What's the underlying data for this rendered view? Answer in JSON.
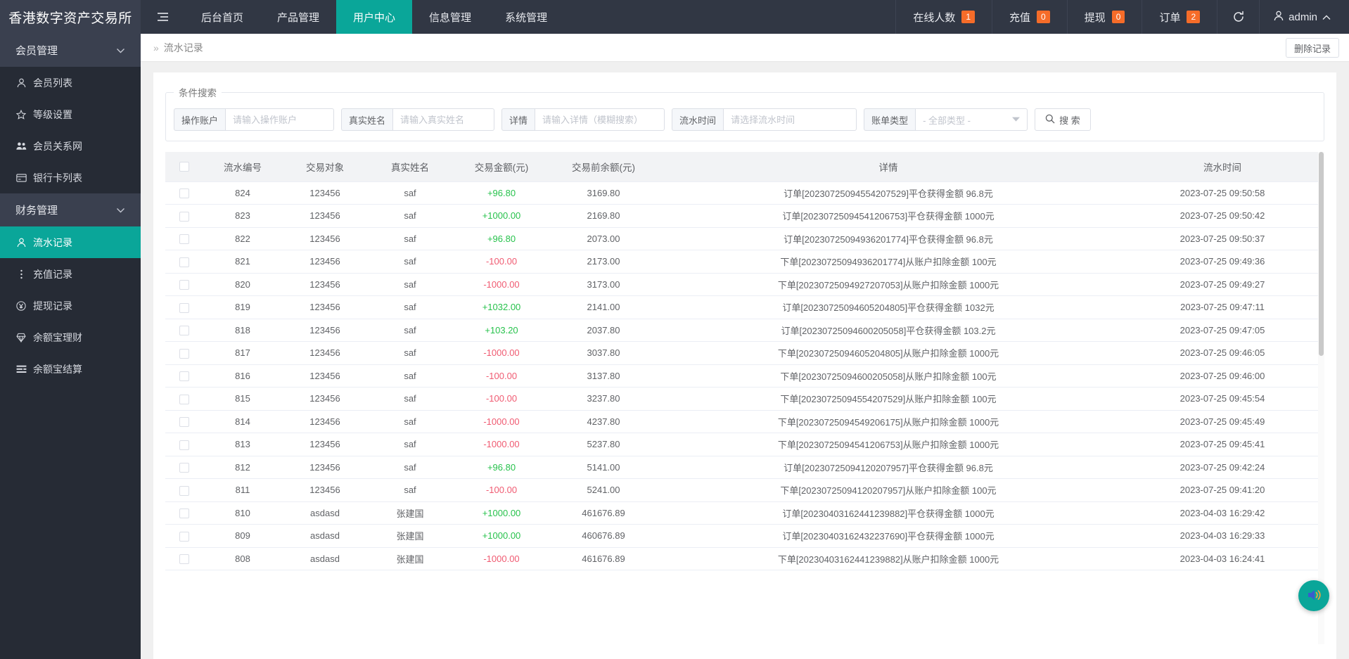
{
  "header": {
    "brand": "香港数字资产交易所",
    "burger_icon": "hamburger-icon",
    "nav": [
      {
        "label": "后台首页",
        "active": false
      },
      {
        "label": "产品管理",
        "active": false
      },
      {
        "label": "用户中心",
        "active": true
      },
      {
        "label": "信息管理",
        "active": false
      },
      {
        "label": "系统管理",
        "active": false
      }
    ],
    "stats": [
      {
        "label": "在线人数",
        "value": "1"
      },
      {
        "label": "充值",
        "value": "0"
      },
      {
        "label": "提现",
        "value": "0"
      },
      {
        "label": "订单",
        "value": "2"
      }
    ],
    "refresh_icon": "refresh-icon",
    "user": {
      "name": "admin",
      "avatar_icon": "user-icon",
      "caret_icon": "chevron-up-icon"
    },
    "badge_color": "#f56c29",
    "accent_color": "#0aa699"
  },
  "sidebar": {
    "groups": [
      {
        "label": "会员管理",
        "items": [
          {
            "label": "会员列表",
            "icon": "user-icon",
            "active": false
          },
          {
            "label": "等级设置",
            "icon": "star-icon",
            "active": false
          },
          {
            "label": "会员关系网",
            "icon": "users-icon",
            "active": false
          },
          {
            "label": "银行卡列表",
            "icon": "card-icon",
            "active": false
          }
        ]
      },
      {
        "label": "财务管理",
        "items": [
          {
            "label": "流水记录",
            "icon": "user-icon",
            "active": true
          },
          {
            "label": "充值记录",
            "icon": "dots-icon",
            "active": false
          },
          {
            "label": "提现记录",
            "icon": "yuan-circle-icon",
            "active": false
          },
          {
            "label": "余额宝理财",
            "icon": "diamond-icon",
            "active": false
          },
          {
            "label": "余额宝结算",
            "icon": "list-icon",
            "active": false
          }
        ]
      }
    ]
  },
  "breadcrumb": {
    "arrows": "»",
    "title": "流水记录"
  },
  "toolbar": {
    "delete_label": "删除记录"
  },
  "search": {
    "legend": "条件搜索",
    "fields": [
      {
        "label": "操作账户",
        "placeholder": "请输入操作账户",
        "value": ""
      },
      {
        "label": "真实姓名",
        "placeholder": "请输入真实姓名",
        "value": ""
      },
      {
        "label": "详情",
        "placeholder": "请输入详情（模糊搜索）",
        "value": ""
      },
      {
        "label": "流水时间",
        "placeholder": "请选择流水时间",
        "value": ""
      }
    ],
    "select": {
      "label": "账单类型",
      "selected": "- 全部类型 -"
    },
    "button": {
      "label": "搜 索",
      "icon": "search-icon"
    }
  },
  "table": {
    "columns": [
      "流水编号",
      "交易对象",
      "真实姓名",
      "交易金额(元)",
      "交易前余额(元)",
      "详情",
      "流水时间"
    ],
    "rows": [
      {
        "id": "824",
        "obj": "123456",
        "name": "saf",
        "amount": "+96.80",
        "sign": "pos",
        "balance": "3169.80",
        "detail": "订单[20230725094554207529]平仓获得金额 96.8元",
        "time": "2023-07-25 09:50:58"
      },
      {
        "id": "823",
        "obj": "123456",
        "name": "saf",
        "amount": "+1000.00",
        "sign": "pos",
        "balance": "2169.80",
        "detail": "订单[20230725094541206753]平仓获得金额 1000元",
        "time": "2023-07-25 09:50:42"
      },
      {
        "id": "822",
        "obj": "123456",
        "name": "saf",
        "amount": "+96.80",
        "sign": "pos",
        "balance": "2073.00",
        "detail": "订单[20230725094936201774]平仓获得金额 96.8元",
        "time": "2023-07-25 09:50:37"
      },
      {
        "id": "821",
        "obj": "123456",
        "name": "saf",
        "amount": "-100.00",
        "sign": "neg",
        "balance": "2173.00",
        "detail": "下单[20230725094936201774]从账户扣除金额 100元",
        "time": "2023-07-25 09:49:36"
      },
      {
        "id": "820",
        "obj": "123456",
        "name": "saf",
        "amount": "-1000.00",
        "sign": "neg",
        "balance": "3173.00",
        "detail": "下单[20230725094927207053]从账户扣除金额 1000元",
        "time": "2023-07-25 09:49:27"
      },
      {
        "id": "819",
        "obj": "123456",
        "name": "saf",
        "amount": "+1032.00",
        "sign": "pos",
        "balance": "2141.00",
        "detail": "订单[20230725094605204805]平仓获得金额 1032元",
        "time": "2023-07-25 09:47:11"
      },
      {
        "id": "818",
        "obj": "123456",
        "name": "saf",
        "amount": "+103.20",
        "sign": "pos",
        "balance": "2037.80",
        "detail": "订单[20230725094600205058]平仓获得金额 103.2元",
        "time": "2023-07-25 09:47:05"
      },
      {
        "id": "817",
        "obj": "123456",
        "name": "saf",
        "amount": "-1000.00",
        "sign": "neg",
        "balance": "3037.80",
        "detail": "下单[20230725094605204805]从账户扣除金额 1000元",
        "time": "2023-07-25 09:46:05"
      },
      {
        "id": "816",
        "obj": "123456",
        "name": "saf",
        "amount": "-100.00",
        "sign": "neg",
        "balance": "3137.80",
        "detail": "下单[20230725094600205058]从账户扣除金额 100元",
        "time": "2023-07-25 09:46:00"
      },
      {
        "id": "815",
        "obj": "123456",
        "name": "saf",
        "amount": "-100.00",
        "sign": "neg",
        "balance": "3237.80",
        "detail": "下单[20230725094554207529]从账户扣除金额 100元",
        "time": "2023-07-25 09:45:54"
      },
      {
        "id": "814",
        "obj": "123456",
        "name": "saf",
        "amount": "-1000.00",
        "sign": "neg",
        "balance": "4237.80",
        "detail": "下单[20230725094549206175]从账户扣除金额 1000元",
        "time": "2023-07-25 09:45:49"
      },
      {
        "id": "813",
        "obj": "123456",
        "name": "saf",
        "amount": "-1000.00",
        "sign": "neg",
        "balance": "5237.80",
        "detail": "下单[20230725094541206753]从账户扣除金额 1000元",
        "time": "2023-07-25 09:45:41"
      },
      {
        "id": "812",
        "obj": "123456",
        "name": "saf",
        "amount": "+96.80",
        "sign": "pos",
        "balance": "5141.00",
        "detail": "订单[20230725094120207957]平仓获得金额 96.8元",
        "time": "2023-07-25 09:42:24"
      },
      {
        "id": "811",
        "obj": "123456",
        "name": "saf",
        "amount": "-100.00",
        "sign": "neg",
        "balance": "5241.00",
        "detail": "下单[20230725094120207957]从账户扣除金额 100元",
        "time": "2023-07-25 09:41:20"
      },
      {
        "id": "810",
        "obj": "asdasd",
        "name": "张建国",
        "amount": "+1000.00",
        "sign": "pos",
        "balance": "461676.89",
        "detail": "订单[20230403162441239882]平仓获得金额 1000元",
        "time": "2023-04-03 16:29:42"
      },
      {
        "id": "809",
        "obj": "asdasd",
        "name": "张建国",
        "amount": "+1000.00",
        "sign": "pos",
        "balance": "460676.89",
        "detail": "订单[20230403162432237690]平仓获得金额 1000元",
        "time": "2023-04-03 16:29:33"
      },
      {
        "id": "808",
        "obj": "asdasd",
        "name": "张建国",
        "amount": "-1000.00",
        "sign": "neg",
        "balance": "461676.89",
        "detail": "下单[20230403162441239882]从账户扣除金额 1000元",
        "time": "2023-04-03 16:24:41"
      }
    ]
  },
  "fab": {
    "icon": "sound-icon"
  }
}
